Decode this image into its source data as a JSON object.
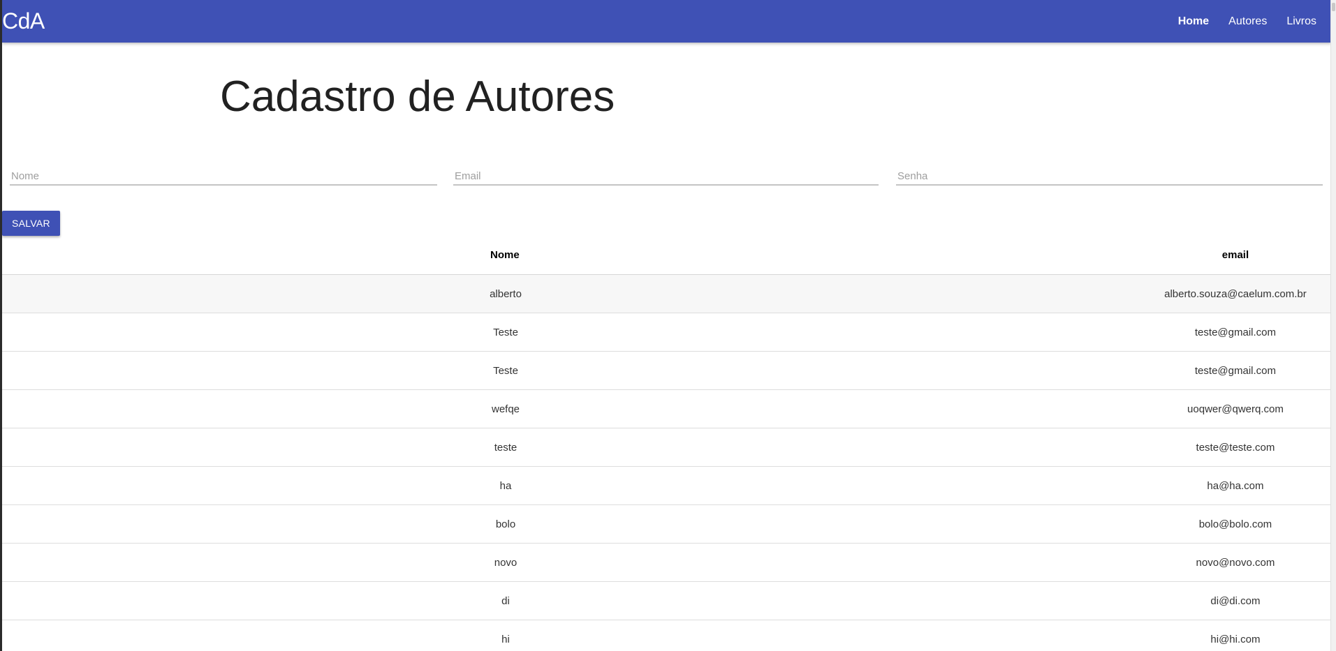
{
  "navbar": {
    "brand": "CdA",
    "links": [
      {
        "label": "Home",
        "active": true
      },
      {
        "label": "Autores",
        "active": false
      },
      {
        "label": "Livros",
        "active": false
      }
    ],
    "color": "#3f51b5"
  },
  "page": {
    "title": "Cadastro de Autores"
  },
  "form": {
    "nome_placeholder": "Nome",
    "email_placeholder": "Email",
    "senha_placeholder": "Senha",
    "nome_value": "",
    "email_value": "",
    "senha_value": "",
    "save_label": "SALVAR"
  },
  "table": {
    "headers": {
      "nome": "Nome",
      "email": "email"
    },
    "rows": [
      {
        "nome": "alberto",
        "email": "alberto.souza@caelum.com.br"
      },
      {
        "nome": "Teste",
        "email": "teste@gmail.com"
      },
      {
        "nome": "Teste",
        "email": "teste@gmail.com"
      },
      {
        "nome": "wefqe",
        "email": "uoqwer@qwerq.com"
      },
      {
        "nome": "teste",
        "email": "teste@teste.com"
      },
      {
        "nome": "ha",
        "email": "ha@ha.com"
      },
      {
        "nome": "bolo",
        "email": "bolo@bolo.com"
      },
      {
        "nome": "novo",
        "email": "novo@novo.com"
      },
      {
        "nome": "di",
        "email": "di@di.com"
      },
      {
        "nome": "hi",
        "email": "hi@hi.com"
      }
    ]
  }
}
